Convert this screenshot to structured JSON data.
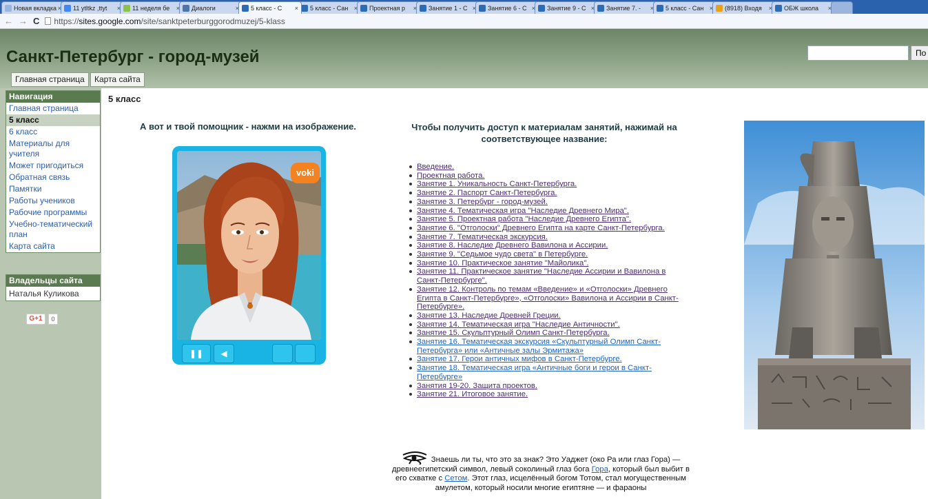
{
  "browser": {
    "tabs": [
      {
        "label": "Новая вкладка",
        "color": "#9ab6de"
      },
      {
        "label": "11 ytltkz ,ttyt",
        "color": "#4285f4"
      },
      {
        "label": "11 неделя бе",
        "color": "#8bc34a"
      },
      {
        "label": "Диалоги",
        "color": "#4a76a8"
      },
      {
        "label": "5 класс - С",
        "color": "#2b6cb5",
        "active": true
      },
      {
        "label": "5 класс - Сан",
        "color": "#2b6cb5"
      },
      {
        "label": "Проектная р",
        "color": "#2b6cb5"
      },
      {
        "label": "Занятие 1 - С",
        "color": "#2b6cb5"
      },
      {
        "label": "Занятие 6 - С",
        "color": "#2b6cb5"
      },
      {
        "label": "Занятие 9 - С",
        "color": "#2b6cb5"
      },
      {
        "label": "Занятие 7. -",
        "color": "#2b6cb5"
      },
      {
        "label": "5 класс - Сан",
        "color": "#2b6cb5"
      },
      {
        "label": "(8918) Входя",
        "color": "#e8a21a"
      },
      {
        "label": "ОБЖ школа",
        "color": "#2b6cb5"
      }
    ],
    "url_prefix": "https://",
    "url_host": "sites.google.com",
    "url_path": "/site/sanktpeterburggorodmuzej/5-klass"
  },
  "site": {
    "title": "Санкт-Петербург - город-музей",
    "search_button": "По",
    "nav_tabs": [
      "Главная страница",
      "Карта сайта"
    ]
  },
  "sidebar": {
    "nav_heading": "Навигация",
    "items": [
      "Главная страница",
      "5 класс",
      "6 класс",
      "Материалы для учителя",
      "Может пригодиться",
      "Обратная связь",
      "Памятки",
      "Работы учеников",
      "Рабочие программы",
      "Учебно-тематический план",
      "Карта сайта"
    ],
    "owners_heading": "Владельцы сайта",
    "owner_name": "Наталья Куликова",
    "gplus_label": "G+1",
    "gplus_count": "0"
  },
  "main": {
    "heading": "5 класс",
    "helper_title": "А вот и твой помощник - нажми на изображение.",
    "materials_title": "Чтобы получить доступ к материалам занятий, нажимай на соответствующее название:",
    "voki_logo": "voki",
    "lessons": [
      "Введение.",
      "Проектная работа.",
      "Занятие 1. Уникальность Санкт-Петербурга.",
      "Занятие 2. Паспорт Санкт-Петербурга.",
      "Занятие 3. Петербург - город-музей.",
      "Занятие 4. Тематическая игра \"Наследие Древнего Мира\".",
      "Занятие 5. Проектная работа \"Наследие Древнего Египта\".",
      "Занятие 6. \"Отголоски\" Древнего Египта на карте Санкт-Петербурга.",
      "Занятие 7. Тематическая экскурсия.",
      "Занятие 8. Наследие Древнего Вавилона и Ассирии.",
      "Занятие 9. \"Седьмое чудо света\" в Петербурге.",
      "Занятие 10. Практическое занятие \"Майолика\".",
      "Занятие 11. Практическое занятие \"Наследие Ассирии и Вавилона в Санкт-Петербурге\".",
      "Занятие 12. Контроль по темам «Введение» и «Отголоски» Древнего Египта в Санкт-Петербурге», «Отголоски» Вавилона и Ассирии в Санкт-Петербурге».",
      "Занятие 13. Наследие Древней Греции.",
      "Занятие 14. Тематическая игра \"Наследие Античности\".",
      "Занятие 15. Скульптурный Олимп Санкт-Петербурга.",
      "Занятие 16. Тематическая экскурсия «Скульптурный Олимп Санкт-Петербурга» или «Античные залы Эрмитажа»",
      "Занятие 17. Герои античных мифов в Санкт-Петербурге.",
      "Занятие 18. Тематическая игра «Античные боги и герои в Санкт-Петербурге»",
      "Занятия 19-20. Защита проектов.",
      "Занятие 21. Итоговое занятие."
    ],
    "eye_text": {
      "part1": " Знаешь ли ты, что это за знак? Это Уаджет (око Ра или глаз Гора) — древнеегипетский символ, левый соколиный глаз бога ",
      "link1": "Гора",
      "part2": ", который был выбит в его схватке с ",
      "link2": "Сетом",
      "part3": ". Этот глаз, исцелённый богом Тотом, стал могущественным амулетом, который носили многие египтяне — и фараоны"
    }
  }
}
